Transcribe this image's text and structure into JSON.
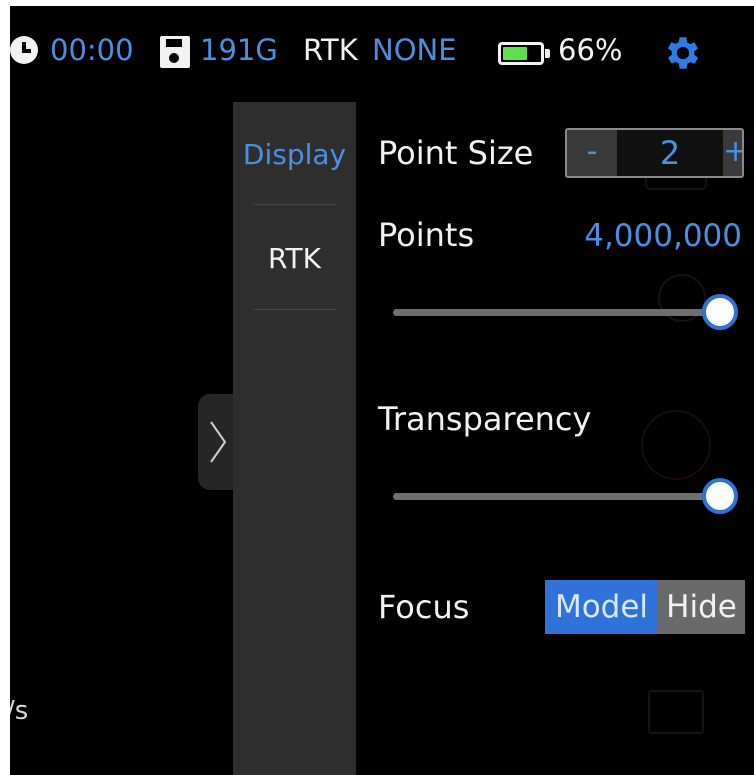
{
  "status_bar": {
    "timer": "00:00",
    "storage": "191G",
    "rtk_label": "RTK",
    "rtk_status": "NONE",
    "battery_percent": "66%",
    "battery_level": 0.66,
    "icons": [
      "clock-icon",
      "sd-card-icon",
      "battery-icon",
      "gear-icon"
    ]
  },
  "menu": {
    "items": [
      {
        "label": "Display",
        "active": true
      },
      {
        "label": "RTK",
        "active": false
      }
    ]
  },
  "display_settings": {
    "point_size": {
      "label": "Point Size",
      "minus": "-",
      "value": "2",
      "plus": "+"
    },
    "points": {
      "label": "Points",
      "value": "4,000,000",
      "slider_level": 1.0
    },
    "transparency": {
      "label": "Transparency",
      "slider_level": 1.0
    },
    "focus": {
      "label": "Focus",
      "options": [
        "Model",
        "Hide"
      ],
      "selected": "Model"
    }
  },
  "background": {
    "speed_fragment": "/s"
  },
  "colors": {
    "accent": "#4a90e2",
    "selected": "#2f73d9",
    "battery_fill": "#5ee04a",
    "background": "#000000",
    "menu_bg": "#2e2e2e"
  }
}
